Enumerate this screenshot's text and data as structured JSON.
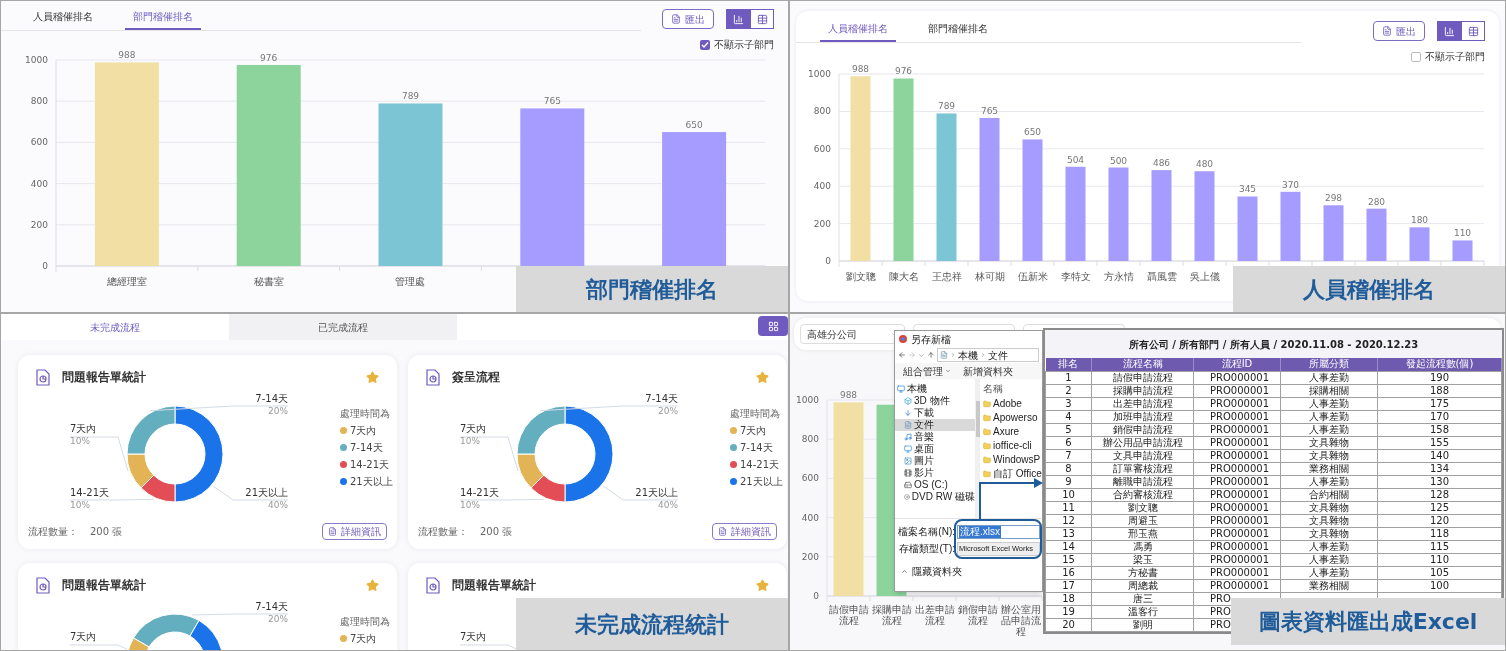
{
  "department_ranking": {
    "tabs": [
      {
        "label": "人員稽催排名",
        "selected": false
      },
      {
        "label": "部門稽催排名",
        "selected": true
      }
    ],
    "export_button": "匯出",
    "view_toggle": [
      {
        "kind": "chart",
        "selected": true
      },
      {
        "kind": "table",
        "selected": false
      }
    ],
    "checkbox": {
      "label": "不顯示子部門",
      "checked": true
    },
    "chart_data": {
      "type": "bar",
      "categories": [
        "總經理室",
        "秘書室",
        "管理處",
        null,
        null
      ],
      "stacked": true,
      "grid": true,
      "ylim": [
        0,
        1000
      ],
      "yticks": [
        0,
        200,
        400,
        600,
        800,
        1000
      ],
      "value_labels": [
        "988",
        "976",
        "789",
        "765",
        "650"
      ],
      "series": [
        {
          "color": "#f1dfa3",
          "values": [
            988,
            null,
            null,
            null,
            null
          ]
        },
        {
          "color": "#8cd49b",
          "values": [
            null,
            976,
            null,
            null,
            null
          ]
        },
        {
          "color": "#7cc5d5",
          "values": [
            null,
            null,
            789,
            null,
            null
          ]
        },
        {
          "color": "#a69bff",
          "values": [
            null,
            null,
            null,
            765,
            650
          ]
        }
      ]
    },
    "caption": "部門稽催排名"
  },
  "staff_ranking": {
    "tabs": [
      {
        "label": "人員稽催排名",
        "selected": true
      },
      {
        "label": "部門稽催排名",
        "selected": false
      }
    ],
    "export_button": "匯出",
    "view_toggle": [
      {
        "kind": "chart",
        "selected": true
      },
      {
        "kind": "table",
        "selected": false
      }
    ],
    "checkbox": {
      "label": "不顯示子部門",
      "checked": false
    },
    "chart_data": {
      "type": "bar",
      "categories": [
        "劉文聰",
        "陳大名",
        "王忠祥",
        "林可期",
        "伍新米",
        "李特文",
        "方永情",
        "聶風雲",
        "吳上儀",
        null,
        null,
        null,
        null,
        null,
        null
      ],
      "stacked": true,
      "grid": true,
      "ylim": [
        0,
        1000
      ],
      "yticks": [
        0,
        200,
        400,
        600,
        800,
        1000
      ],
      "value_labels": [
        "988",
        "976",
        "789",
        "765",
        "650",
        "504",
        "500",
        "486",
        "480",
        "345",
        "370",
        "298",
        "280",
        "180",
        "110"
      ],
      "series": [
        {
          "color": "#f1dfa3",
          "values": [
            988,
            null,
            null,
            null,
            null,
            null,
            null,
            null,
            null,
            null,
            null,
            null,
            null,
            null,
            null
          ]
        },
        {
          "color": "#8cd49b",
          "values": [
            null,
            976,
            null,
            null,
            null,
            null,
            null,
            null,
            null,
            null,
            null,
            null,
            null,
            null,
            null
          ]
        },
        {
          "color": "#7cc5d5",
          "values": [
            null,
            null,
            789,
            null,
            null,
            null,
            null,
            null,
            null,
            null,
            null,
            null,
            null,
            null,
            null
          ]
        },
        {
          "color": "#a69bff",
          "values": [
            null,
            null,
            null,
            765,
            650,
            504,
            500,
            486,
            480,
            345,
            370,
            298,
            280,
            180,
            110
          ]
        }
      ]
    },
    "caption": "人員稽催排名"
  },
  "pending_flows": {
    "tabs": [
      {
        "label": "未完成流程",
        "selected": true
      },
      {
        "label": "已完成流程",
        "selected": false
      }
    ],
    "cards": [
      {
        "kind": "full",
        "title": "問題報告單統計",
        "starred": true,
        "chart_data": {
          "type": "donut",
          "categories": [
            "21天以上",
            "14-21天",
            "7天內",
            "7-14天"
          ],
          "values": [
            40,
            10,
            10,
            20
          ],
          "value_labels": [
            "40%",
            "10%",
            "10%",
            "20%"
          ],
          "colors": [
            "#1a73e8",
            "#e34d55",
            "#e2b455",
            "#64afbf"
          ]
        },
        "legend_title": "處理時間為",
        "legend": [
          {
            "label": "7天內",
            "color": "#e2b455"
          },
          {
            "label": "7-14天",
            "color": "#64afbf"
          },
          {
            "label": "14-21天",
            "color": "#e34d55"
          },
          {
            "label": "21天以上",
            "color": "#1a73e8"
          }
        ],
        "count_label": "流程數量：",
        "count": "200 張",
        "detail_button": "詳細資訊"
      },
      {
        "kind": "full",
        "title": "簽呈流程",
        "starred": true,
        "chart_data": {
          "type": "donut",
          "categories": [
            "21天以上",
            "14-21天",
            "7天內",
            "7-14天"
          ],
          "values": [
            40,
            10,
            10,
            20
          ],
          "value_labels": [
            "40%",
            "10%",
            "10%",
            "20%"
          ],
          "colors": [
            "#1a73e8",
            "#e34d55",
            "#e2b455",
            "#64afbf"
          ]
        },
        "legend_title": "處理時間為",
        "legend": [
          {
            "label": "7天內",
            "color": "#e2b455"
          },
          {
            "label": "7-14天",
            "color": "#64afbf"
          },
          {
            "label": "14-21天",
            "color": "#e34d55"
          },
          {
            "label": "21天以上",
            "color": "#1a73e8"
          }
        ],
        "count_label": "流程數量：",
        "count": "200 張",
        "detail_button": "詳細資訊"
      },
      {
        "kind": "partial",
        "title": "問題報告單統計",
        "starred": true,
        "callouts": [
          {
            "kind": "right",
            "label": "7-14天",
            "value": "20%"
          },
          {
            "kind": "left",
            "label": "7天內"
          }
        ],
        "legend_title": "處理時間為",
        "legend": [
          {
            "label": "7天內",
            "color": "#e2b455"
          }
        ]
      },
      {
        "kind": "partial",
        "title": "問題報告單統計",
        "starred": true,
        "callouts": [
          {
            "kind": "left",
            "label": "7天內"
          }
        ]
      }
    ],
    "caption": "未完成流程統計"
  },
  "excel_export": {
    "filter_select": "高雄分公司",
    "chart_data": {
      "type": "bar",
      "categories": [
        "請假申請流程",
        "採購申請流程",
        "出差申請流程",
        "銷假申請流程",
        "辦公室用品申請流程"
      ],
      "stacked": true,
      "grid": true,
      "ylim": [
        0,
        1000
      ],
      "yticks": [
        0,
        200,
        400,
        600,
        800,
        1000
      ],
      "value_labels": [
        "988",
        null,
        null,
        null,
        null
      ],
      "series": [
        {
          "color": "#f1dfa3",
          "values": [
            988,
            null,
            null,
            null,
            null
          ]
        },
        {
          "color": "#8cd49b",
          "values": [
            null,
            976,
            null,
            null,
            null
          ]
        }
      ]
    },
    "dialog": {
      "title": "另存新檔",
      "path": [
        "本機",
        "文件"
      ],
      "toolbar": [
        "組合管理",
        "新增資料夾"
      ],
      "tree": [
        {
          "label": "本機",
          "kind": "pc",
          "selected": false,
          "children": [
            {
              "label": "3D 物件",
              "kind": "cube",
              "selected": false
            },
            {
              "label": "下載",
              "kind": "download",
              "selected": false
            },
            {
              "label": "文件",
              "kind": "document",
              "selected": true
            },
            {
              "label": "音樂",
              "kind": "music",
              "selected": false
            },
            {
              "label": "桌面",
              "kind": "desktop",
              "selected": false
            },
            {
              "label": "圖片",
              "kind": "picture",
              "selected": false
            },
            {
              "label": "影片",
              "kind": "video",
              "selected": false
            },
            {
              "label": "OS (C:)",
              "kind": "drive",
              "selected": false
            },
            {
              "label": "DVD RW 磁碟",
              "kind": "disc",
              "selected": false
            }
          ]
        }
      ],
      "column_header": "名稱",
      "folders": [
        "Adobe",
        "Apowerso",
        "Axure",
        "ioffice-cli",
        "WindowsP",
        "自訂 Office"
      ],
      "filename_label": "檔案名稱(N):",
      "filename": "流程.xlsx",
      "filetype_label": "存檔類型(T):",
      "filetype": "Microsoft Excel Works",
      "hide_folders": "隱藏資料夾"
    },
    "table": {
      "title": "所有公司 / 所有部門 / 所有人員 / 2020.11.08 - 2020.12.23",
      "columns": [
        "排名",
        "流程名稱",
        "流程ID",
        "所屬分類",
        "發起流程數(個)"
      ],
      "rows": [
        [
          "1",
          "請假申請流程",
          "PRO000001",
          "人事差勤",
          "190"
        ],
        [
          "2",
          "採購申請流程",
          "PRO000001",
          "採購相關",
          "188"
        ],
        [
          "3",
          "出差申請流程",
          "PRO000001",
          "人事差勤",
          "175"
        ],
        [
          "4",
          "加班申請流程",
          "PRO000001",
          "人事差勤",
          "170"
        ],
        [
          "5",
          "銷假申請流程",
          "PRO000001",
          "人事差勤",
          "158"
        ],
        [
          "6",
          "辦公用品申請流程",
          "PRO000001",
          "文具雜物",
          "155"
        ],
        [
          "7",
          "文具申請流程",
          "PRO000001",
          "文具雜物",
          "140"
        ],
        [
          "8",
          "訂單審核流程",
          "PRO000001",
          "業務相關",
          "134"
        ],
        [
          "9",
          "離職申請流程",
          "PRO000001",
          "人事差勤",
          "130"
        ],
        [
          "10",
          "合約審核流程",
          "PRO000001",
          "合約相關",
          "128"
        ],
        [
          "11",
          "劉文聰",
          "PRO000001",
          "文具雜物",
          "125"
        ],
        [
          "12",
          "周避玉",
          "PRO000001",
          "文具雜物",
          "120"
        ],
        [
          "13",
          "邢玉燕",
          "PRO000001",
          "文具雜物",
          "118"
        ],
        [
          "14",
          "馮勇",
          "PRO000001",
          "人事差勤",
          "115"
        ],
        [
          "15",
          "梁玉",
          "PRO000001",
          "人事差勤",
          "110"
        ],
        [
          "16",
          "方秘書",
          "PRO000001",
          "人事差勤",
          "105"
        ],
        [
          "17",
          "周總裁",
          "PRO000001",
          "業務相關",
          "100"
        ],
        [
          "18",
          "唐三",
          "PRO"
        ],
        [
          "19",
          "溫客行",
          "PRO"
        ],
        [
          "20",
          "劉明",
          "PRO"
        ]
      ]
    },
    "caption": "圖表資料匯出成Excel"
  }
}
